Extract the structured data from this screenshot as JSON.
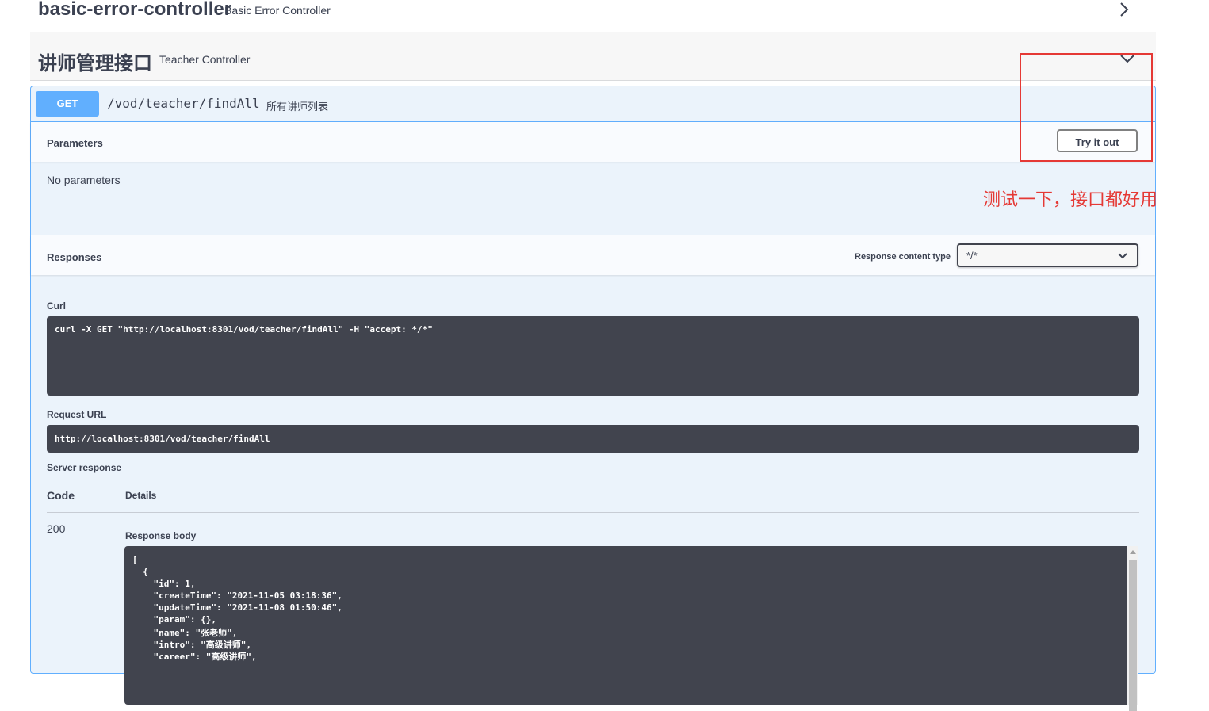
{
  "tags": [
    {
      "name": "basic-error-controller",
      "description": "Basic Error Controller"
    },
    {
      "name": "讲师管理接口",
      "description": "Teacher Controller"
    }
  ],
  "operation": {
    "method": "GET",
    "path": "/vod/teacher/findAll",
    "summary": "所有讲师列表",
    "parameters_title": "Parameters",
    "try_label": "Try it out",
    "no_params": "No parameters",
    "responses_title": "Responses",
    "content_type_label": "Response content type",
    "content_type_value": "*/*",
    "curl_label": "Curl",
    "curl_command": "curl -X GET \"http://localhost:8301/vod/teacher/findAll\" -H \"accept: */*\"",
    "request_url_label": "Request URL",
    "request_url": "http://localhost:8301/vod/teacher/findAll",
    "server_response_label": "Server response",
    "code_header": "Code",
    "details_header": "Details",
    "status_code": "200",
    "response_body_label": "Response body",
    "response_body_lines": [
      "[",
      "  {",
      "    \"id\": 1,",
      "    \"createTime\": \"2021-11-05 03:18:36\",",
      "    \"updateTime\": \"2021-11-08 01:50:46\",",
      "    \"param\": {},",
      "    \"name\": \"张老师\",",
      "    \"intro\": \"高级讲师\",",
      "    \"career\": \"高级讲师\","
    ]
  },
  "annotation": {
    "text": "测试一下，接口都好用",
    "color": "#e53935"
  },
  "colors": {
    "get_accent": "#61affe",
    "code_bg": "#41444e",
    "text": "#3b4151"
  }
}
